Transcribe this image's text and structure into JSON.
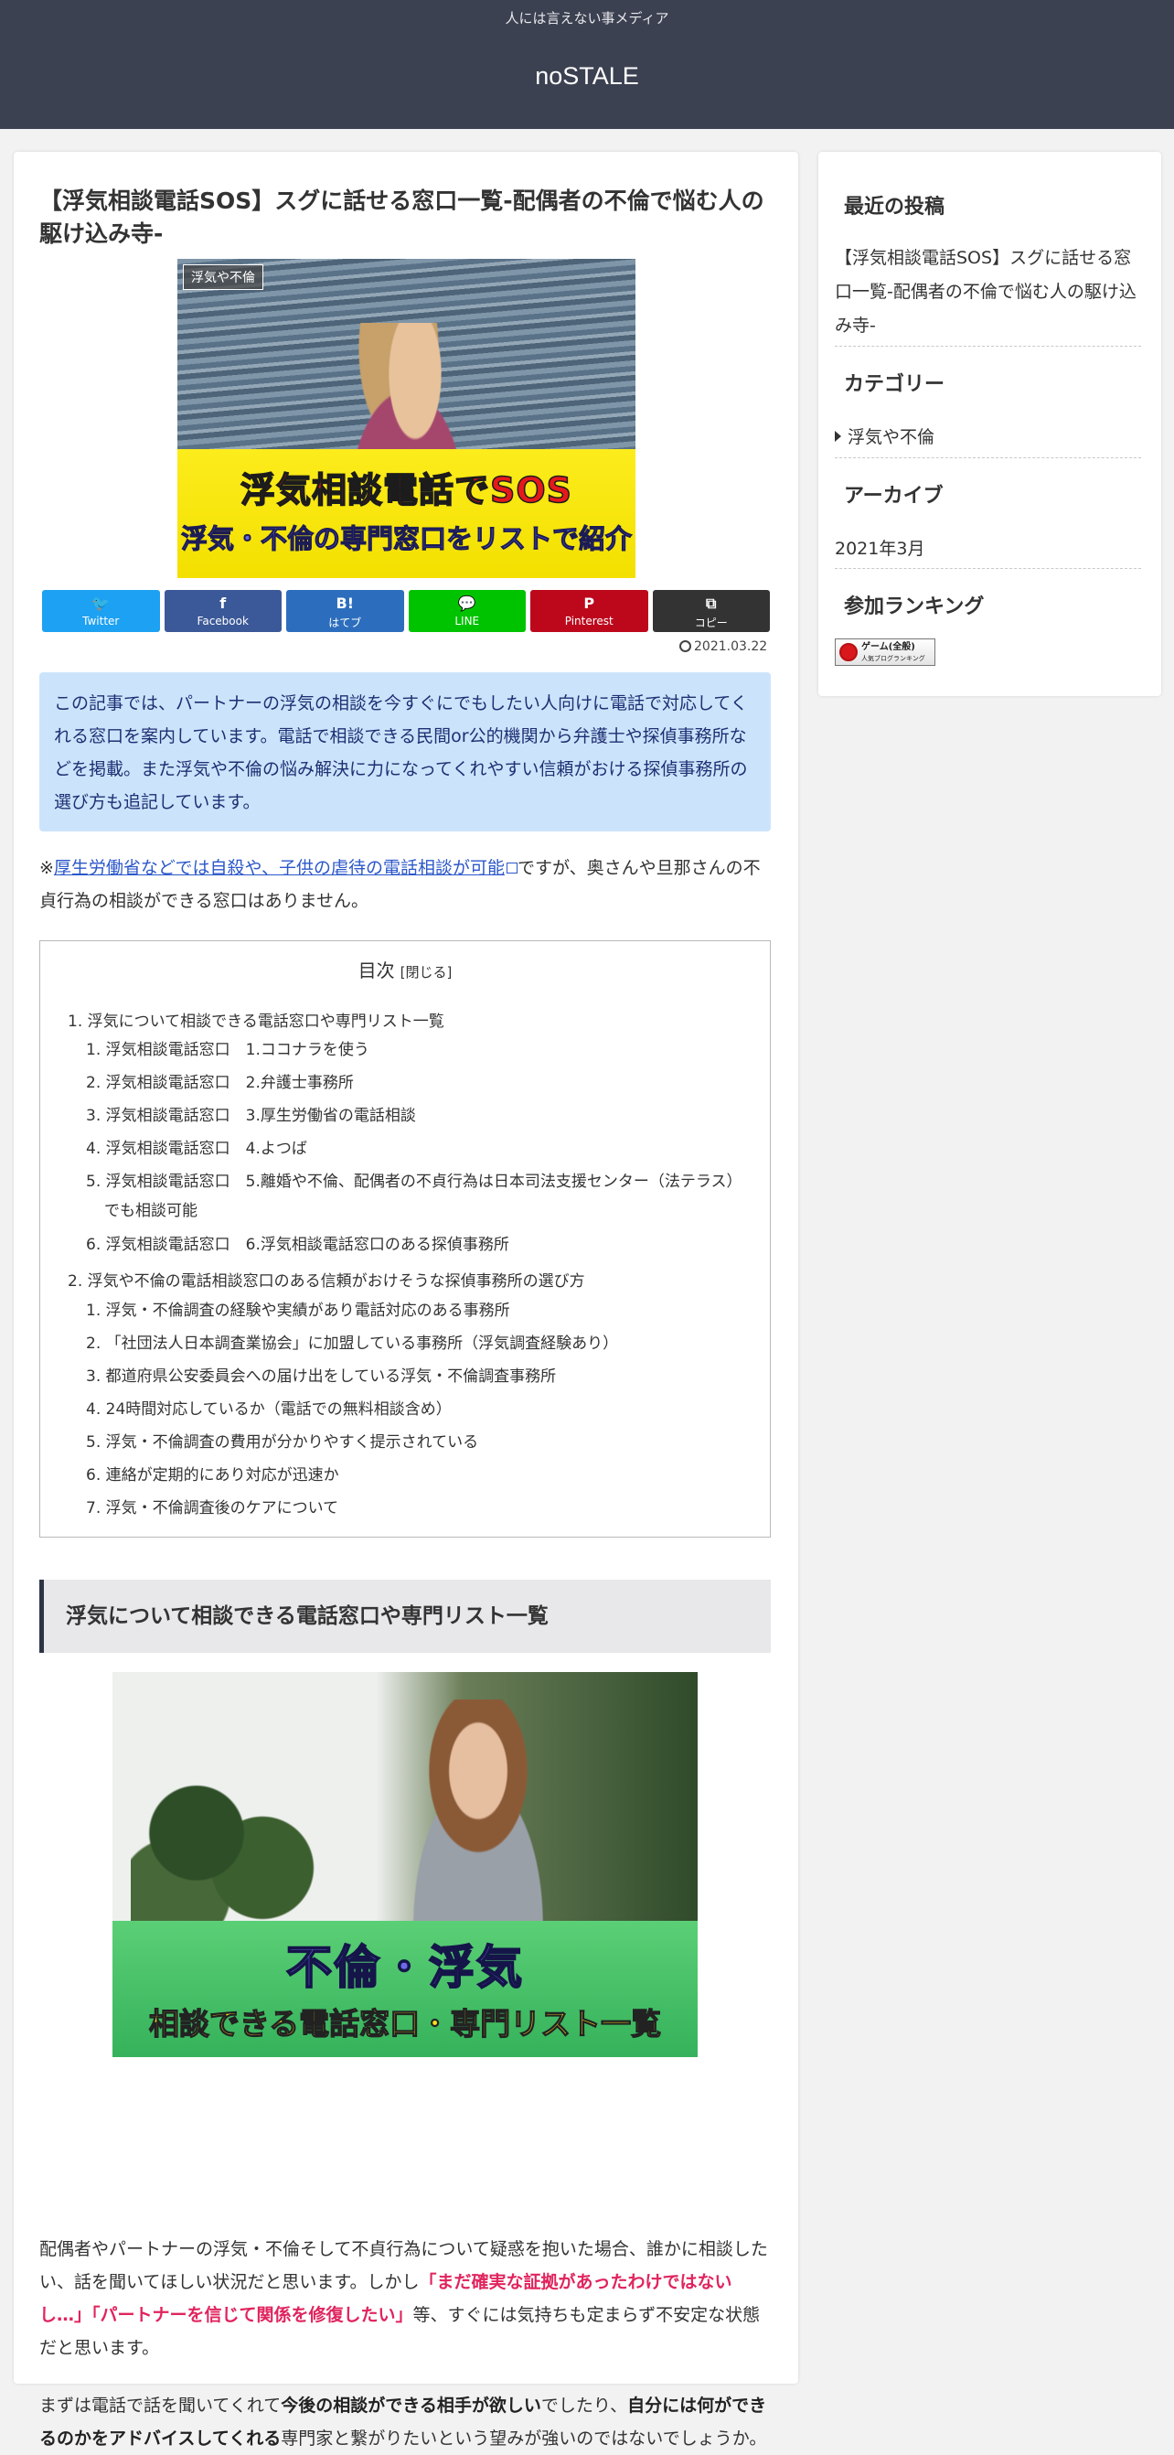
{
  "header": {
    "tagline": "人には言えない事メディア",
    "site_name": "noSTALE"
  },
  "article": {
    "title": "【浮気相談電話SOS】スグに話せる窓口一覧-配偶者の不倫で悩む人の駆け込み寺-",
    "category_label": "浮気や不倫",
    "eyecatch": {
      "line1": "浮気相談電話でSOS",
      "line2": "浮気・不倫の専門窓口をリストで紹介"
    },
    "share": [
      {
        "icon": "🐦",
        "label": "Twitter",
        "color": "#1da1f2",
        "icon_name": "twitter-icon"
      },
      {
        "icon": "f",
        "label": "Facebook",
        "color": "#3b5998",
        "icon_name": "facebook-icon"
      },
      {
        "icon": "B!",
        "label": "はてブ",
        "color": "#2c6ebd",
        "icon_name": "hatena-icon"
      },
      {
        "icon": "💬",
        "label": "LINE",
        "color": "#00c300",
        "icon_name": "line-icon"
      },
      {
        "icon": "P",
        "label": "Pinterest",
        "color": "#bd081c",
        "icon_name": "pinterest-icon"
      },
      {
        "icon": "⧉",
        "label": "コピー",
        "color": "#333333",
        "icon_name": "copy-icon"
      }
    ],
    "date": "2021.03.22",
    "lead": "この記事では、パートナーの浮気の相談を今すぐにでもしたい人向けに電話で対応してくれる窓口を案内しています。電話で相談できる民間or公的機関から弁護士や探偵事務所などを掲載。また浮気や不倫の悩み解決に力になってくれやすい信頼がおける探偵事務所の選び方も追記しています。",
    "para1": {
      "prefix": "※",
      "link": "厚生労働省などでは自殺や、子供の虐待の電話相談が可能",
      "suffix": "ですが、奥さんや旦那さんの不貞行為の相談ができる窓口はありません。"
    },
    "toc": {
      "title": "目次",
      "toggle": "[閉じる]",
      "sections": [
        {
          "label": "1. 浮気について相談できる電話窓口や専門リスト一覧",
          "items": [
            "1. 浮気相談電話窓口　1.ココナラを使う",
            "2. 浮気相談電話窓口　2.弁護士事務所",
            "3. 浮気相談電話窓口　3.厚生労働省の電話相談",
            "4. 浮気相談電話窓口　4.よつば",
            "5. 浮気相談電話窓口　5.離婚や不倫、配偶者の不貞行為は日本司法支援センター（法テラス）でも相談可能",
            "6. 浮気相談電話窓口　6.浮気相談電話窓口のある探偵事務所"
          ]
        },
        {
          "label": "2. 浮気や不倫の電話相談窓口のある信頼がおけそうな探偵事務所の選び方",
          "items": [
            "1. 浮気・不倫調査の経験や実績があり電話対応のある事務所",
            "2. 「社団法人日本調査業協会」に加盟している事務所（浮気調査経験あり）",
            "3. 都道府県公安委員会への届け出をしている浮気・不倫調査事務所",
            "4. 24時間対応しているか（電話での無料相談含め）",
            "5. 浮気・不倫調査の費用が分かりやすく提示されている",
            "6. 連絡が定期的にあり対応が迅速か",
            "7. 浮気・不倫調査後のケアについて"
          ]
        }
      ]
    },
    "h2": "浮気について相談できる電話窓口や専門リスト一覧",
    "image2": {
      "line1": "不倫・浮気",
      "line2": "相談できる電話窓口・専門リスト一覧"
    },
    "para2": {
      "t1": "配偶者やパートナーの浮気・不倫そして不貞行為について疑惑を抱いた場合、誰かに相談したい、話を聞いてほしい状況だと思います。しかし",
      "red1": "「まだ確実な証拠があったわけではないし…」「パートナーを信じて関係を修復したい」",
      "t2": "等、すぐには気持ちも定まらず不安定な状態だと思います。"
    },
    "para3": {
      "t1": "まずは電話で話を聞いてくれて",
      "b1": "今後の相談ができる相手が欲しい",
      "t2": "でしたり、",
      "b2": "自分には何ができるのかをアドバイスしてくれる",
      "t3": "専門家と繋がりたいという望みが強いのではないでしょうか。"
    }
  },
  "sidebar": {
    "recent_title": "最近の投稿",
    "recent_post": "【浮気相談電話SOS】スグに話せる窓口一覧-配偶者の不倫で悩む人の駆け込み寺-",
    "category_title": "カテゴリー",
    "category_item": "浮気や不倫",
    "archive_title": "アーカイブ",
    "archive_item": "2021年3月",
    "ranking_title": "参加ランキング",
    "ranking_banner": "ゲーム(全般)",
    "ranking_banner_sub": "人気ブログランキング"
  }
}
